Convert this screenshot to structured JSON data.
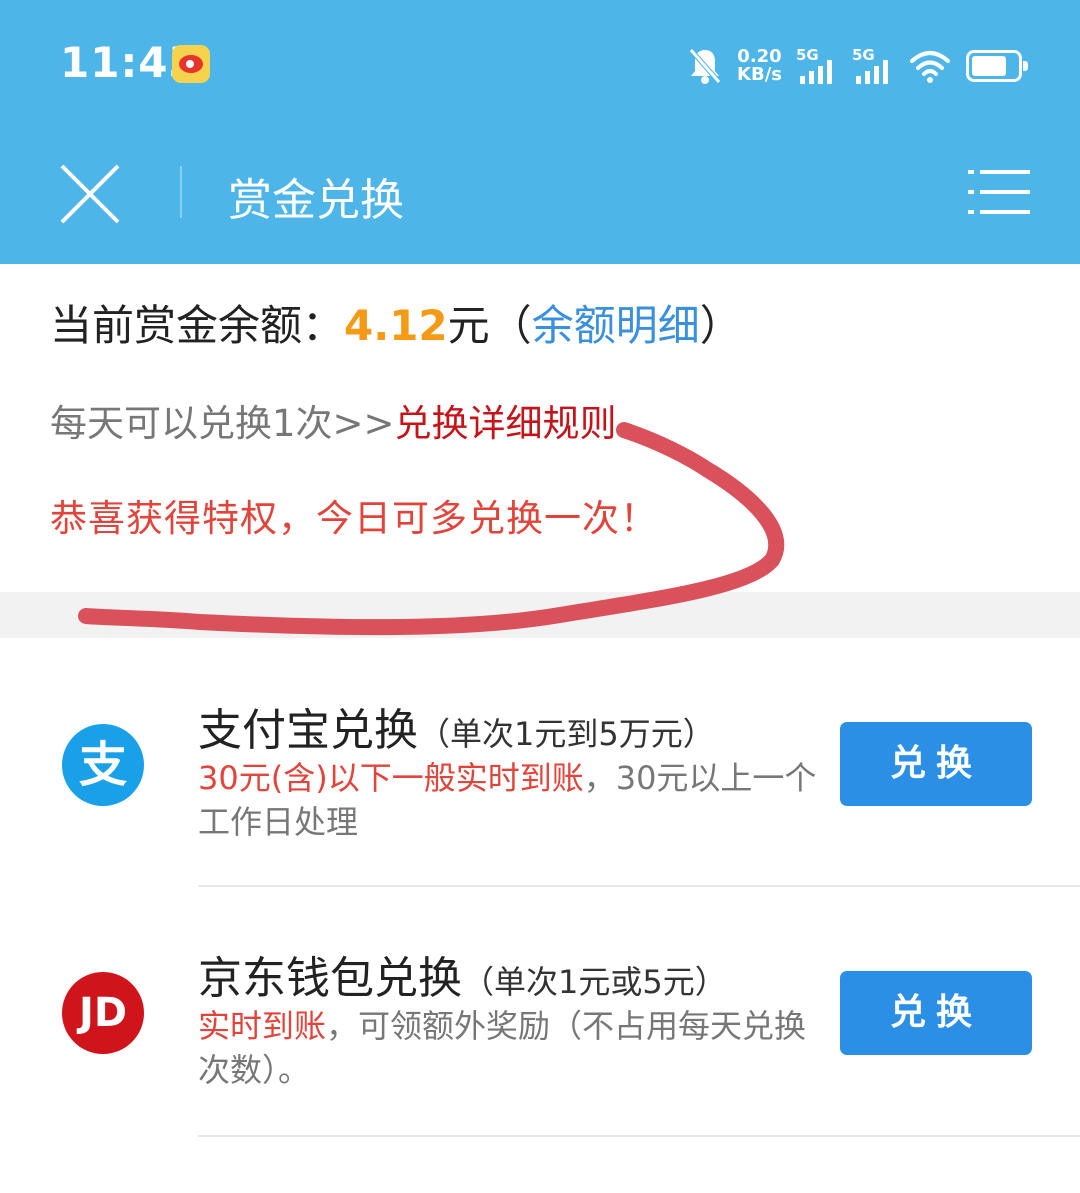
{
  "status_bar": {
    "time": "11:43",
    "net_speed_value": "0.20",
    "net_speed_unit": "KB/s",
    "sim1_label": "5G",
    "sim2_label": "5G",
    "icons": [
      "weibo-icon",
      "bell-mute-icon",
      "signal-icon",
      "wifi-icon",
      "battery-icon"
    ]
  },
  "nav": {
    "title": "赏金兑换",
    "close_icon": "close-icon",
    "menu_icon": "menu-icon"
  },
  "balance": {
    "label": "当前赏金余额：",
    "amount": "4.12",
    "unit": "元",
    "paren_open": "（",
    "detail_link": "余额明细",
    "paren_close": "）"
  },
  "rule": {
    "prefix": "每天可以兑换1次>>",
    "link": "兑换详细规则"
  },
  "privilege_text": "恭喜获得特权，今日可多兑换一次！",
  "exchange_options": [
    {
      "icon": "alipay-icon",
      "icon_glyph": "支",
      "title": "支付宝兑换",
      "subtitle": "（单次1元到5万元）",
      "desc_highlight": "30元(含)以下一般实时到账",
      "desc_rest": "，30元以上一个工作日处理",
      "button": "兑换"
    },
    {
      "icon": "jd-icon",
      "icon_glyph": "JD",
      "title": "京东钱包兑换",
      "subtitle": "（单次1元或5元）",
      "desc_highlight": "实时到账",
      "desc_rest": "，可领额外奖励（不占用每天兑换次数）。",
      "button": "兑换"
    }
  ],
  "colors": {
    "header_bg": "#4db5e8",
    "amount": "#f59a17",
    "link_blue": "#3a8fde",
    "rule_red": "#c4141a",
    "highlight_red": "#e0443a",
    "button_blue": "#2b8fe6",
    "alipay_blue": "#1aa0e8",
    "jd_red": "#d0141b",
    "scribble_red": "#d9515a"
  }
}
